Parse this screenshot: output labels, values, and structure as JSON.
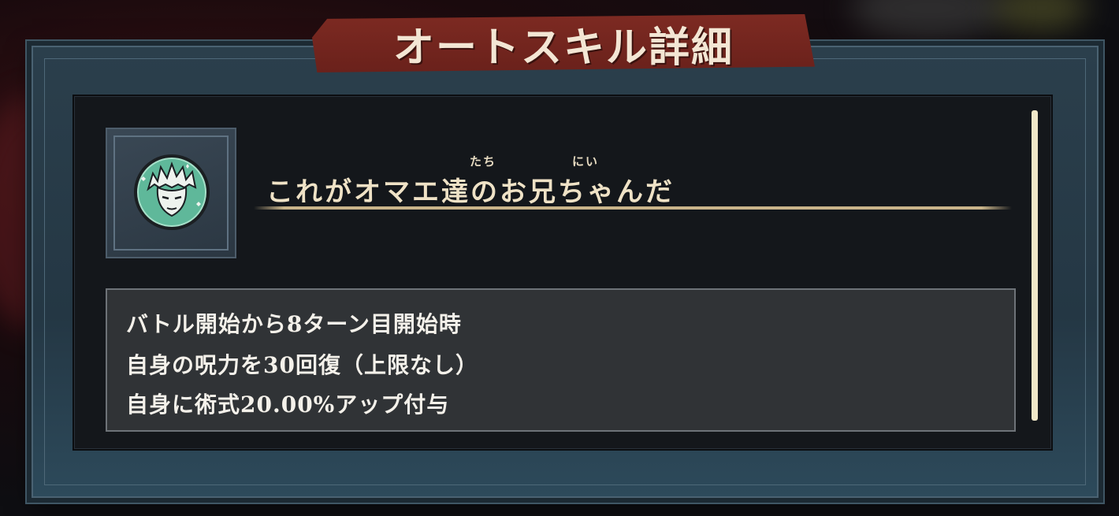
{
  "dialog": {
    "title": "オートスキル詳細"
  },
  "skill": {
    "icon": "character-portrait-emblem",
    "accent_color": "#5fb89a",
    "name": "これがオマエ達のお兄ちゃんだ",
    "ruby": {
      "tachi": "たち",
      "nii": "にい"
    },
    "description": [
      "バトル開始から8ターン目開始時",
      "自身の呪力を30回復（上限なし）",
      "自身に術式20.00%アップ付与"
    ]
  }
}
